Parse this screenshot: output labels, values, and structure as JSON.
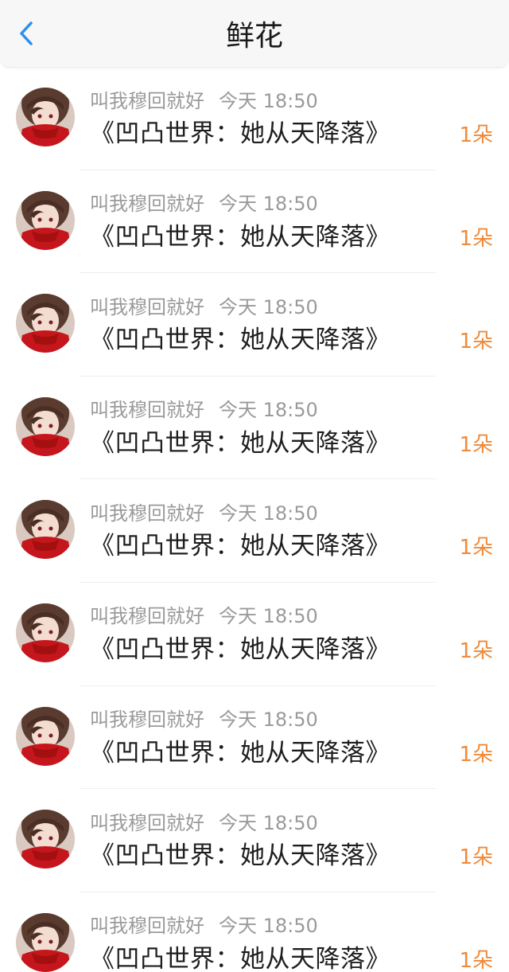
{
  "header": {
    "back_icon": "chevron-left-icon",
    "title": "鲜花"
  },
  "colors": {
    "accent_back": "#2b8ff0",
    "count": "#ef8a3a",
    "meta": "#9a9a9a"
  },
  "items": [
    {
      "user": "叫我穆回就好",
      "time": "今天 18:50",
      "title": "《凹凸世界：她从天降落》",
      "count": "1朵"
    },
    {
      "user": "叫我穆回就好",
      "time": "今天 18:50",
      "title": "《凹凸世界：她从天降落》",
      "count": "1朵"
    },
    {
      "user": "叫我穆回就好",
      "time": "今天 18:50",
      "title": "《凹凸世界：她从天降落》",
      "count": "1朵"
    },
    {
      "user": "叫我穆回就好",
      "time": "今天 18:50",
      "title": "《凹凸世界：她从天降落》",
      "count": "1朵"
    },
    {
      "user": "叫我穆回就好",
      "time": "今天 18:50",
      "title": "《凹凸世界：她从天降落》",
      "count": "1朵"
    },
    {
      "user": "叫我穆回就好",
      "time": "今天 18:50",
      "title": "《凹凸世界：她从天降落》",
      "count": "1朵"
    },
    {
      "user": "叫我穆回就好",
      "time": "今天 18:50",
      "title": "《凹凸世界：她从天降落》",
      "count": "1朵"
    },
    {
      "user": "叫我穆回就好",
      "time": "今天 18:50",
      "title": "《凹凸世界：她从天降落》",
      "count": "1朵"
    },
    {
      "user": "叫我穆回就好",
      "time": "今天 18:50",
      "title": "《凹凸世界：她从天降落》",
      "count": "1朵"
    }
  ]
}
